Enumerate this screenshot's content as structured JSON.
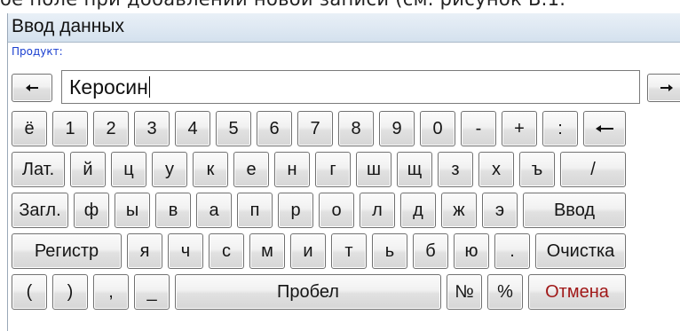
{
  "background_text": "ое поле при добавлении новой записи (см. рисунок В.1.",
  "window": {
    "title": "Ввод данных",
    "field_label": "Продукт:",
    "input_value": "Керосин"
  },
  "keyboard": {
    "row1": [
      "ё",
      "1",
      "2",
      "3",
      "4",
      "5",
      "6",
      "7",
      "8",
      "9",
      "0",
      "-",
      "+",
      ":"
    ],
    "row2": [
      "Лат.",
      "й",
      "ц",
      "у",
      "к",
      "е",
      "н",
      "г",
      "ш",
      "щ",
      "з",
      "х",
      "ъ",
      "/"
    ],
    "row3": [
      "Загл.",
      "ф",
      "ы",
      "в",
      "а",
      "п",
      "р",
      "о",
      "л",
      "д",
      "ж",
      "э",
      "Ввод"
    ],
    "row4": [
      "Регистр",
      "я",
      "ч",
      "с",
      "м",
      "и",
      "т",
      "ь",
      "б",
      "ю",
      ".",
      "Очистка"
    ],
    "row5": [
      "(",
      ")",
      ",",
      "_",
      "Пробел",
      "№",
      "%",
      "Отмена"
    ]
  },
  "icons": {
    "left": "arrow-left-icon",
    "right": "arrow-right-icon",
    "backspace": "backspace-icon"
  },
  "colors": {
    "label": "#1a3fd0",
    "cancel_text": "#a01818",
    "window_bg": "#dfe9f4"
  }
}
